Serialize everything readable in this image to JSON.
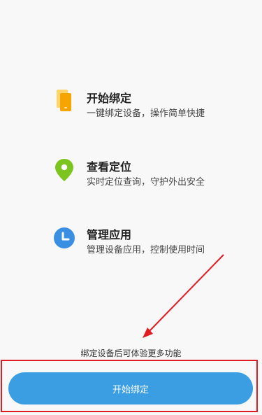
{
  "features": [
    {
      "title": "开始绑定",
      "desc": "一键绑定设备，操作简单快捷",
      "icon": "phone-icon",
      "color": "#f6b21c"
    },
    {
      "title": "查看定位",
      "desc": "实时定位查询，守护外出安全",
      "icon": "location-pin-icon",
      "color": "#7bc51e"
    },
    {
      "title": "管理应用",
      "desc": "管理设备应用，控制使用时间",
      "icon": "clock-icon",
      "color": "#3b8fe3"
    }
  ],
  "hint": "绑定设备后可体验更多功能",
  "primary_button": "开始绑定",
  "colors": {
    "button": "#3b9ee3",
    "annotation": "#e11b22"
  }
}
